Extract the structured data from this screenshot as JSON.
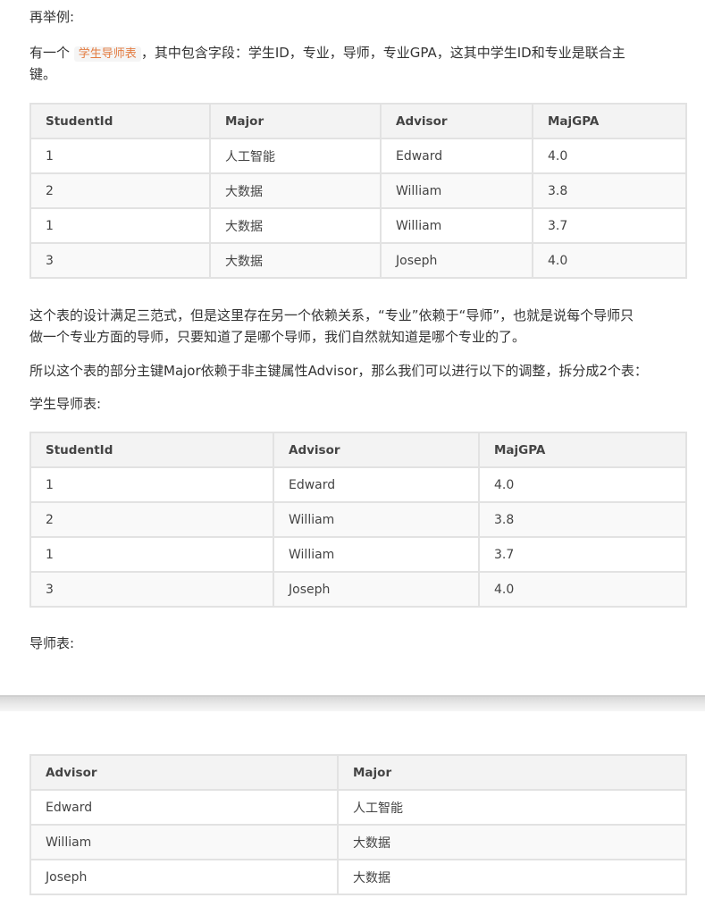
{
  "intro": {
    "heading": "再举例:",
    "p1_before": "有一个",
    "p1_code": "学生导师表",
    "p1_after": "，其中包含字段：学生ID，专业，导师，专业GPA，这其中学生ID和专业是联合主",
    "p1_line2": "键。"
  },
  "table1": {
    "headers": [
      "StudentId",
      "Major",
      "Advisor",
      "MajGPA"
    ],
    "rows": [
      [
        "1",
        "人工智能",
        "Edward",
        "4.0"
      ],
      [
        "2",
        "大数据",
        "William",
        "3.8"
      ],
      [
        "1",
        "大数据",
        "William",
        "3.7"
      ],
      [
        "3",
        "大数据",
        "Joseph",
        "4.0"
      ]
    ]
  },
  "body": {
    "p2_line1": "这个表的设计满足三范式，但是这里存在另一个依赖关系，“专业”依赖于“导师”，也就是说每个导师只",
    "p2_line2": "做一个专业方面的导师，只要知道了是哪个导师，我们自然就知道是哪个专业的了。",
    "p3": "所以这个表的部分主键Major依赖于非主键属性Advisor，那么我们可以进行以下的调整，拆分成2个表：",
    "label_student_advisor": "学生导师表:"
  },
  "table2": {
    "headers": [
      "StudentId",
      "Advisor",
      "MajGPA"
    ],
    "rows": [
      [
        "1",
        "Edward",
        "4.0"
      ],
      [
        "2",
        "William",
        "3.8"
      ],
      [
        "1",
        "William",
        "3.7"
      ],
      [
        "3",
        "Joseph",
        "4.0"
      ]
    ]
  },
  "label_advisor": "导师表:",
  "table3": {
    "headers": [
      "Advisor",
      "Major"
    ],
    "rows": [
      [
        "Edward",
        "人工智能"
      ],
      [
        "William",
        "大数据"
      ],
      [
        "Joseph",
        "大数据"
      ]
    ]
  }
}
